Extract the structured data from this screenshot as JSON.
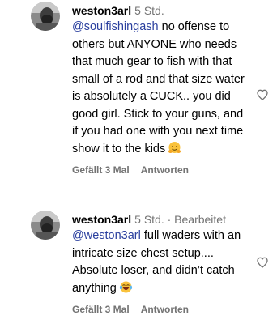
{
  "comments": [
    {
      "username": "weston3arl",
      "meta": "5 Std.",
      "mention": "@soulfishingash",
      "text": " no offense to others but ANYONE who needs that much gear to fish with that small of a rod and that size water is absolutely a CUCK.. you did good girl. Stick to your guns, and if you had one with you next time show it to the kids",
      "emoji": "hugging-face-emoji",
      "likes_label": "Gefällt 3 Mal",
      "reply_label": "Antworten"
    },
    {
      "username": "weston3arl",
      "meta": "5 Std. · Bearbeitet",
      "mention": "@weston3arl",
      "text": " full waders with an intricate size chest setup.... Absolute loser, and didn’t catch anything",
      "emoji": "laughing-tears-emoji",
      "likes_label": "Gefällt 3 Mal",
      "reply_label": "Antworten"
    }
  ],
  "colors": {
    "mention": "#2a3f9e",
    "meta": "#737373",
    "text": "#000000"
  }
}
